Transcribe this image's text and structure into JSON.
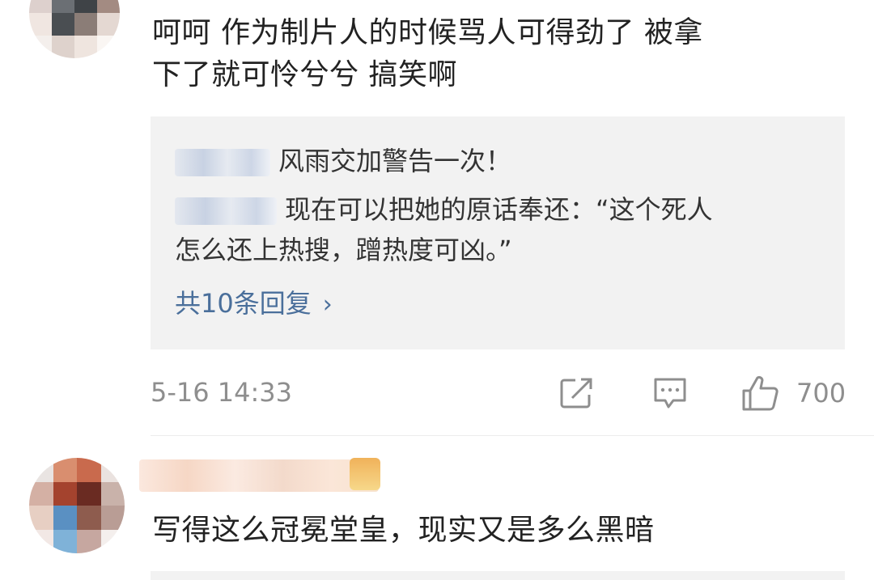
{
  "comments": [
    {
      "text_line1": "呵呵 作为制片人的时候骂人可得劲了 被拿",
      "text_line2": "下了就可怜兮兮 搞笑啊",
      "replies": [
        {
          "text": "风雨交加警告一次！"
        },
        {
          "text_line1": "现在可以把她的原话奉还：“这个死人",
          "text_line2": "怎么还上热搜，蹭热度可凶。”"
        }
      ],
      "more_replies_label": "共10条回复",
      "more_replies_chevron": "›",
      "timestamp": "5-16 14:33",
      "like_count": "700",
      "icons": {
        "share": "share-icon",
        "comment": "comment-icon",
        "like": "thumbs-up-icon"
      }
    },
    {
      "text": "写得这么冠冕堂皇，现实又是多么黑暗"
    }
  ],
  "colors": {
    "link": "#4a6f9b",
    "meta": "#8e8e8e",
    "reply_bg": "#f2f2f2",
    "text": "#222222"
  }
}
